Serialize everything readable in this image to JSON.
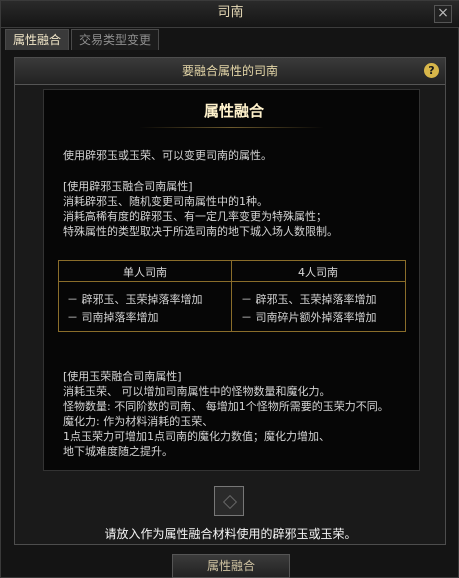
{
  "window": {
    "title": "司南",
    "close_label": "×"
  },
  "tabs": [
    {
      "label": "属性融合"
    },
    {
      "label": "交易类型变更"
    }
  ],
  "panel": {
    "header": "要融合属性的司南",
    "help_label": "?"
  },
  "popup": {
    "title": "属性融合",
    "intro": "使用辟邪玉或玉荣、可以变更司南的属性。",
    "section1": [
      "[使用辟邪玉融合司南属性]",
      "消耗辟邪玉、随机变更司南属性中的1种。",
      "消耗高稀有度的辟邪玉、有一定几率变更为特殊属性；",
      "特殊属性的类型取决于所选司南的地下城入场人数限制。"
    ],
    "table": {
      "headers": [
        "单人司南",
        "4人司南"
      ],
      "left": [
        "－ 辟邪玉、玉荣掉落率增加",
        "－ 司南掉落率增加"
      ],
      "right": [
        "－ 辟邪玉、玉荣掉落率增加",
        "－ 司南碎片额外掉落率增加"
      ]
    },
    "section2": [
      "[使用玉荣融合司南属性]",
      "消耗玉荣、 可以增加司南属性中的怪物数量和魔化力。",
      "怪物数量: 不同阶数的司南、 每增加1个怪物所需要的玉荣力不同。",
      "魔化力: 作为材料消耗的玉荣、",
      "1点玉荣力可增加1点司南的魔化力数值；魔化力增加、",
      "地下城难度随之提升。"
    ]
  },
  "hint": "请放入作为属性融合材料使用的辟邪玉或玉荣。",
  "bottom_button": "属性融合"
}
